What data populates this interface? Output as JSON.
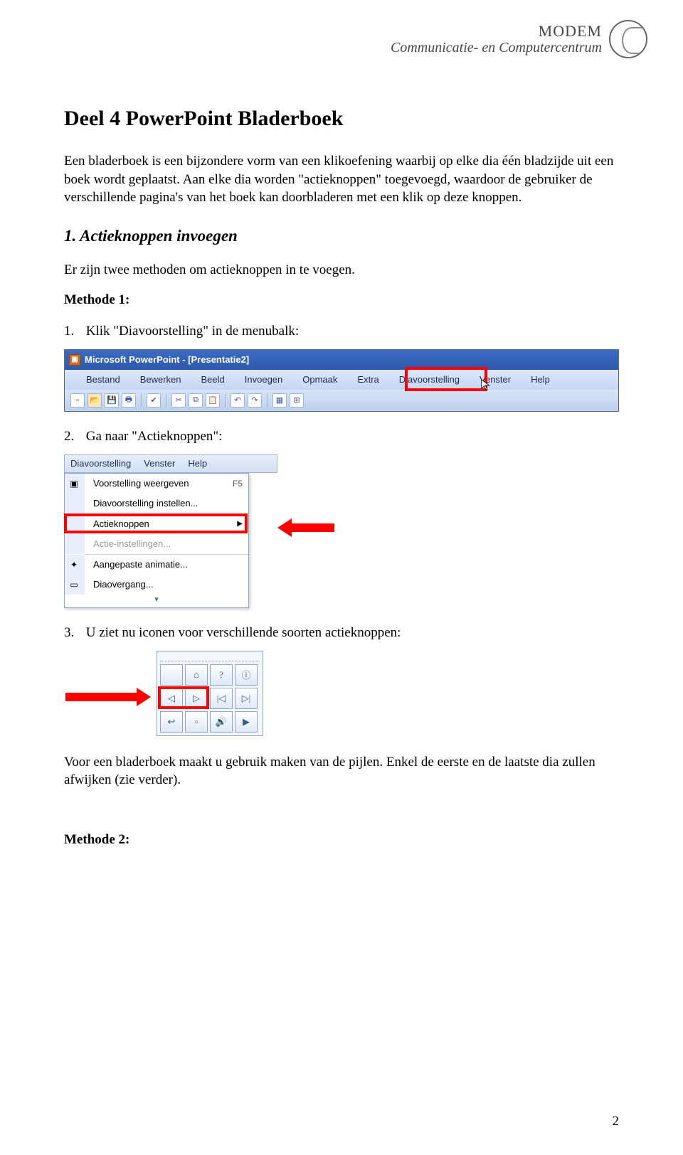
{
  "header": {
    "line1": "MODEM",
    "line2": "Communicatie- en Computercentrum"
  },
  "title": "Deel 4    PowerPoint Bladerboek",
  "intro_p1": "Een bladerboek is een bijzondere vorm van een klikoefening waarbij op elke dia één bladzijde uit een boek wordt geplaatst. Aan elke dia worden \"actieknoppen\" toegevoegd, waardoor de gebruiker de verschillende pagina's van het boek kan doorbladeren met een klik op deze knoppen.",
  "section1_heading": "1.   Actieknoppen invoegen",
  "section1_intro": "Er zijn twee methoden om actieknoppen in te voegen.",
  "method1_label": "Methode 1:",
  "steps": {
    "s1_num": "1.",
    "s1_text": "Klik \"Diavoorstelling\" in de menubalk:",
    "s2_num": "2.",
    "s2_text": "Ga naar \"Actieknoppen\":",
    "s3_num": "3.",
    "s3_text": "U ziet nu iconen voor verschillende soorten actieknoppen:"
  },
  "fig1": {
    "titlebar": "Microsoft PowerPoint - [Presentatie2]",
    "menu": [
      "Bestand",
      "Bewerken",
      "Beeld",
      "Invoegen",
      "Opmaak",
      "Extra",
      "Diavoorstelling",
      "Venster",
      "Help"
    ]
  },
  "fig2": {
    "top": [
      "Diavoorstelling",
      "Venster",
      "Help"
    ],
    "items": [
      {
        "label": "Voorstelling weergeven",
        "key": "F5",
        "icon": "▣"
      },
      {
        "label": "Diavoorstelling instellen...",
        "key": "",
        "icon": ""
      },
      {
        "label": "Actieknoppen",
        "key": "",
        "icon": "",
        "arrow": "▶"
      },
      {
        "label": "Actie-instellingen...",
        "key": "",
        "icon": "",
        "disabled": true
      },
      {
        "label": "Aangepaste animatie...",
        "key": "",
        "icon": "✦"
      },
      {
        "label": "Diaovergang...",
        "key": "",
        "icon": "▭"
      }
    ]
  },
  "fig3": {
    "icons": [
      "",
      "⌂",
      "?",
      "ⓘ",
      "◁",
      "▷",
      "|◁",
      "▷|",
      "↩",
      "▫",
      "🔊",
      "▶"
    ]
  },
  "closing_note": "Voor een bladerboek maakt u gebruik maken van de pijlen.  Enkel de eerste en de laatste dia zullen afwijken (zie verder).",
  "method2_label": "Methode 2:",
  "page_number": "2"
}
